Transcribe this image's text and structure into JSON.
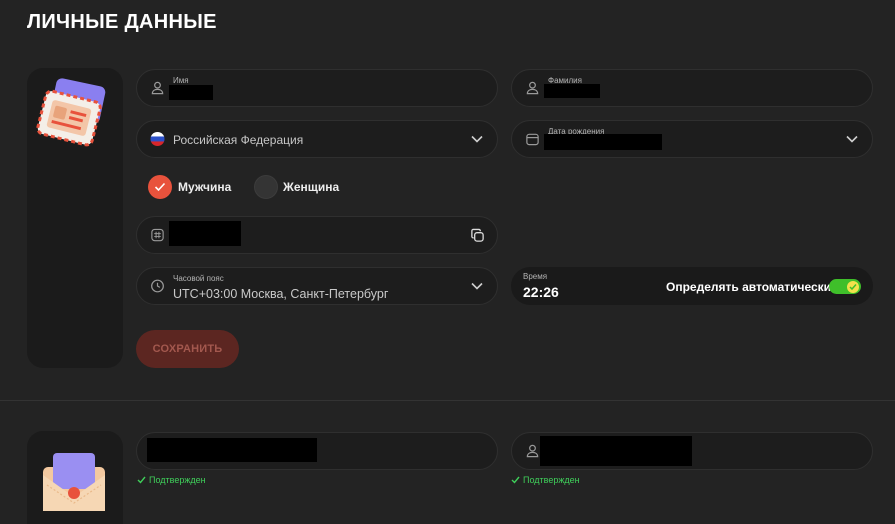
{
  "section": {
    "title": "ЛИЧНЫЕ ДАННЫЕ"
  },
  "personal": {
    "first_name_label": "Имя",
    "last_name_label": "Фамилия",
    "country": "Российская Федерация",
    "birthdate_label": "Дата рождения",
    "gender": {
      "male": "Мужчина",
      "female": "Женщина",
      "selected": "male"
    },
    "timezone_label": "Часовой пояс",
    "timezone_value": "UTC+03:00 Москва, Санкт-Петербург",
    "time_label": "Время",
    "time_value": "22:26",
    "auto_detect_label": "Определять автоматически",
    "auto_detect_on": true,
    "save_label": "СОХРАНИТЬ"
  },
  "contacts": {
    "email_status": "Подтвержден",
    "phone_status": "Подтвержден"
  },
  "colors": {
    "accent": "#e8523c",
    "toggle": "#3fbf2a",
    "verified": "#3fcf5a"
  },
  "icons": [
    "user-icon",
    "russia-flag-icon",
    "calendar-icon",
    "hash-icon",
    "copy-icon",
    "clock-icon",
    "chevron-down-icon",
    "check-icon",
    "id-card-illustration",
    "envelope-illustration"
  ]
}
